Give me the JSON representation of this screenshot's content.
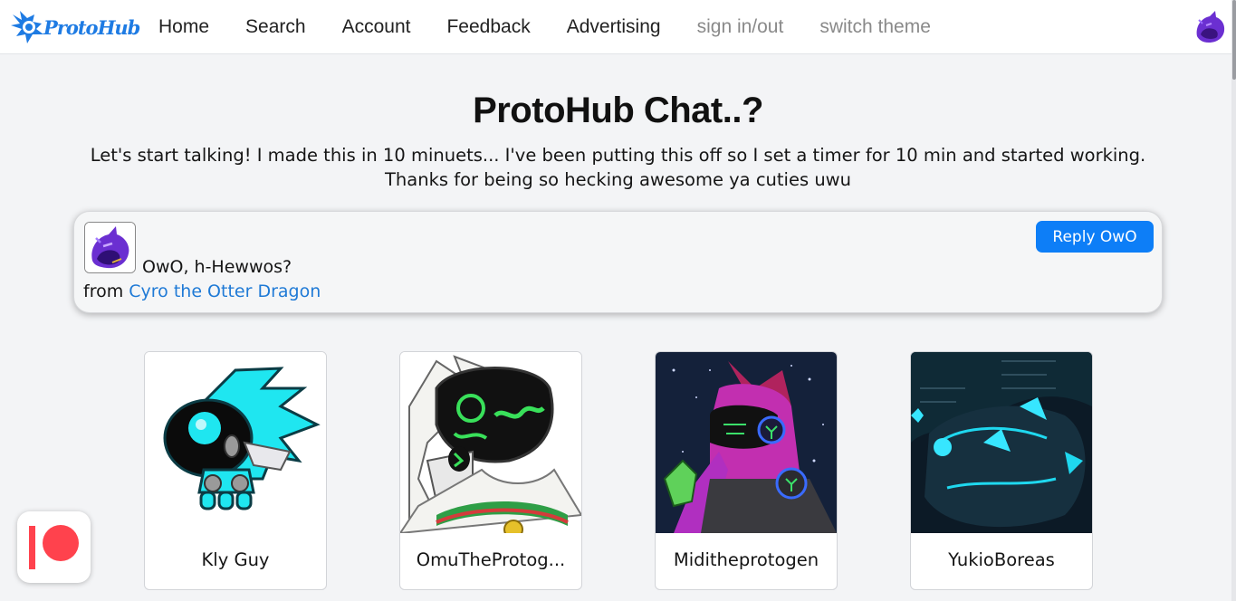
{
  "brand": {
    "name": "ProtoHub",
    "color": "#1e7be3",
    "icon": "protohub-logo-icon"
  },
  "nav": {
    "links": [
      "Home",
      "Search",
      "Account",
      "Feedback",
      "Advertising"
    ],
    "muted_links": [
      "sign in/out",
      "switch theme"
    ],
    "avatar_icon": "user-avatar-icon"
  },
  "hero": {
    "title": "ProtoHub Chat..?",
    "description_line1": "Let's start talking! I made this in 10 minuets... I've been putting this off so I set a timer for 10 min and started working.",
    "description_line2": "Thanks for being so hecking awesome ya cuties uwu"
  },
  "chat": {
    "message": "OwO, h-Hewwos?",
    "from_label": "from",
    "author": "Cyro the Otter Dragon",
    "reply_label": "Reply OwO",
    "accent": "#0d7ef7",
    "link_color": "#1f7ad6"
  },
  "profiles": [
    {
      "name": "Kly Guy",
      "image_icon": "cyan-protogen-avatar"
    },
    {
      "name": "OmuTheProtog...",
      "image_icon": "green-visor-protogen-avatar"
    },
    {
      "name": "Miditheprotogen",
      "image_icon": "purple-protogen-avatar"
    },
    {
      "name": "YukioBoreas",
      "image_icon": "blue-glow-protogen-avatar"
    }
  ],
  "patreon": {
    "icon": "patreon-icon",
    "color": "#ff424d"
  }
}
